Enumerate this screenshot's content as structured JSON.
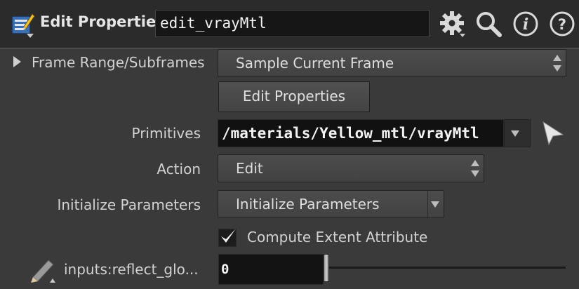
{
  "header": {
    "node_icon": "edit-properties-node-icon",
    "node_type_label": "Edit Properties",
    "node_name": "edit_vrayMtl",
    "icons": [
      "gear-icon",
      "search-icon",
      "info-icon",
      "help-icon"
    ]
  },
  "params": {
    "frame_range": {
      "label": "Frame Range/Subframes",
      "value": "Sample Current Frame"
    },
    "edit_properties_button": "Edit Properties",
    "primitives": {
      "label": "Primitives",
      "value": "/materials/Yellow_mtl/vrayMtl"
    },
    "action": {
      "label": "Action",
      "value": "Edit"
    },
    "initialize_parameters": {
      "label": "Initialize Parameters",
      "value": "Initialize Parameters"
    },
    "compute_extent": {
      "label": "Compute Extent Attribute",
      "checked": true
    },
    "reflect_glossiness": {
      "label": "inputs:reflect_glo...",
      "value": "0",
      "slider_fraction": 0
    }
  },
  "colors": {
    "background": "#3a3a3a",
    "header_bg": "#2b2b2b",
    "field_bg": "#131313",
    "text": "#d8d8d8"
  }
}
